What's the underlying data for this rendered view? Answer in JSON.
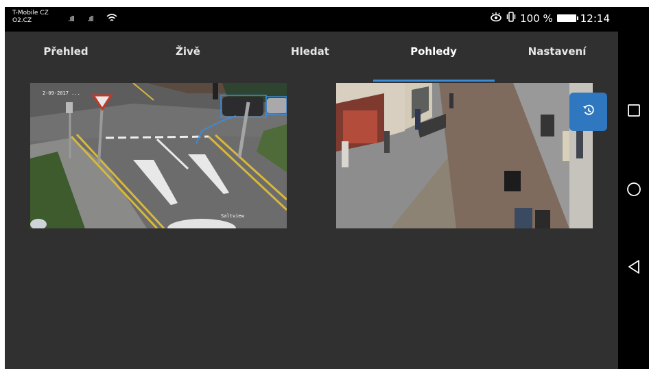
{
  "status_bar": {
    "carrier_primary": "T-Mobile CZ",
    "carrier_secondary": "O2.CZ",
    "signal_1": ".ıll",
    "signal_2": ".ıll",
    "icons": [
      "eye-icon",
      "vibrate-icon",
      "battery-icon"
    ],
    "battery": "100 %",
    "time": "12:14"
  },
  "tabs": [
    {
      "label": "Přehled",
      "active": false
    },
    {
      "label": "Živě",
      "active": false
    },
    {
      "label": "Hledat",
      "active": false
    },
    {
      "label": "Pohledy",
      "active": true
    },
    {
      "label": "Nastavení",
      "active": false
    }
  ],
  "cameras": [
    {
      "name": "intersection-camera",
      "timestamp": "2-09-2017 ...",
      "watermark": "Saltview"
    },
    {
      "name": "street-camera"
    }
  ],
  "restore_button": {
    "icon": "history-icon"
  },
  "nav_buttons": [
    "recents-icon",
    "home-icon",
    "back-icon"
  ],
  "colors": {
    "accent": "#3d8bd4",
    "background": "#303030",
    "button": "#2f78c0"
  }
}
